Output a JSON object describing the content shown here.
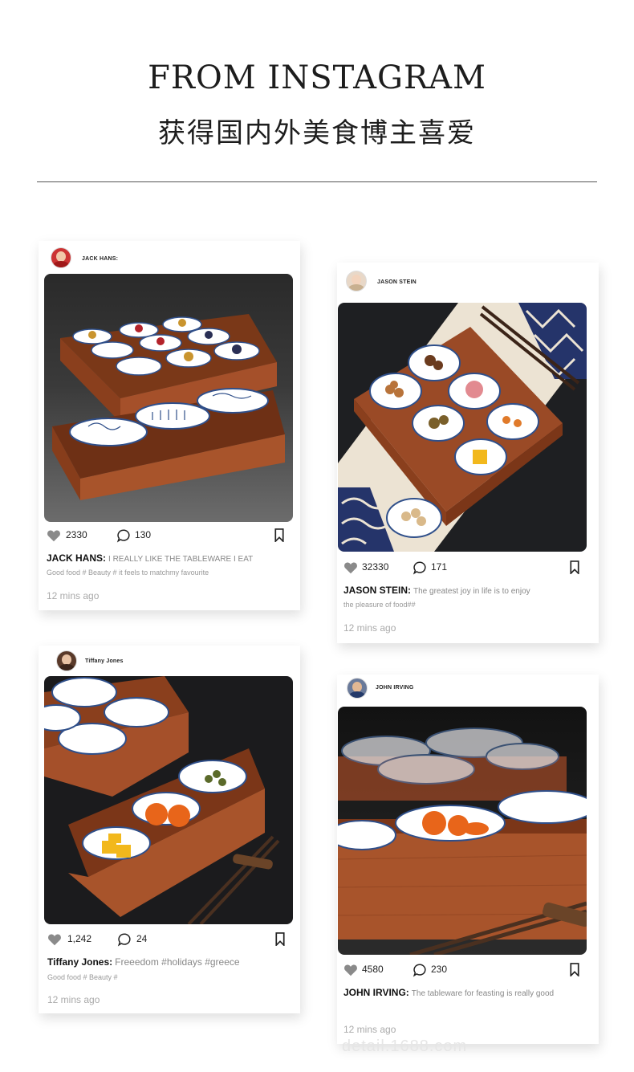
{
  "header": {
    "title_en": "FROM INSTAGRAM",
    "title_cn": "获得国内外美食博主喜爱"
  },
  "posts": [
    {
      "username": "JACK HANS:",
      "likes": "2330",
      "comments": "130",
      "author": "JACK HANS:",
      "caption": "I REALLY LIKE THE TABLEWARE I EAT",
      "tags": "Good food # Beauty #   it feels to matchmy favourite",
      "time": "12 mins ago"
    },
    {
      "username": "JASON STEIN",
      "likes": "32330",
      "comments": "171",
      "author": "JASON STEIN:",
      "caption": "The greatest joy in life is to enjoy",
      "tags": "the pleasure of food##",
      "time": "12 mins ago"
    },
    {
      "username": "Tiffany Jones",
      "likes": "1,242",
      "comments": "24",
      "author": "Tiffany Jones:",
      "caption": "Freeedom #holidays #greece",
      "tags": "Good food # Beauty #",
      "time": "12 mins ago"
    },
    {
      "username": "JOHN IRVING",
      "likes": "4580",
      "comments": "230",
      "author": "JOHN IRVING:",
      "caption": "The tableware for feasting is really good",
      "tags": "",
      "time": "12 mins ago"
    }
  ],
  "watermark": "detail.1688.com",
  "colors": {
    "wood": "#9a4a26",
    "porcelain_blue": "#2f4f8a",
    "dark_bg": "#1f1f1f"
  }
}
